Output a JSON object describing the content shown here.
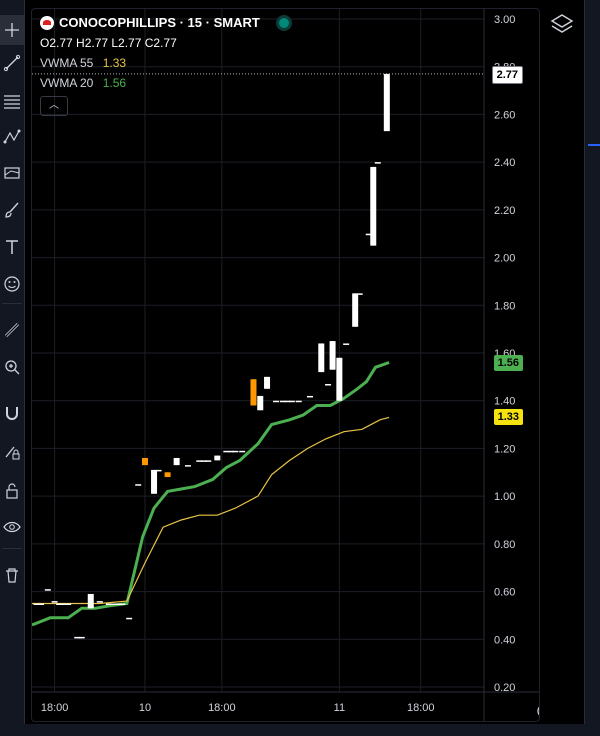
{
  "symbol": {
    "title": "CONOCOPHILLIPS · 15 · SMART",
    "ohlc": "O2.77 H2.77 L2.77 C2.77"
  },
  "indicators": [
    {
      "name": "VWMA 55",
      "value": "1.33",
      "color": "#e8c547"
    },
    {
      "name": "VWMA 20",
      "value": "1.56",
      "color": "#4caf50"
    }
  ],
  "price_tags": {
    "last": "2.77",
    "vwma20": "1.56",
    "vwma55": "1.33"
  },
  "colors": {
    "up": "#ffffff",
    "down": "#ff9800",
    "vwma20": "#4caf50",
    "vwma55": "#e8c547",
    "accent": "#2962ff"
  },
  "toolbar": {
    "icons": [
      "crosshair-icon",
      "trend-line-icon",
      "fib-icon",
      "pattern-icon",
      "forecast-icon",
      "brush-icon",
      "text-icon",
      "emoji-icon",
      "ruler-icon",
      "zoom-icon",
      "magnet-icon",
      "lock-drawings-icon",
      "lock-icon",
      "eye-icon",
      "trash-icon"
    ]
  },
  "chart_data": {
    "type": "candlestick",
    "y_axis": {
      "min": 0.2,
      "max": 3.0,
      "ticks": [
        "3.00",
        "2.80",
        "2.60",
        "2.40",
        "2.20",
        "2.00",
        "1.80",
        "1.60",
        "1.40",
        "1.20",
        "1.00",
        "0.80",
        "0.60",
        "0.40",
        "0.20"
      ]
    },
    "x_axis": {
      "labels": [
        "18:00",
        "10",
        "18:00",
        "11",
        "18:00"
      ],
      "positions": [
        0.05,
        0.25,
        0.42,
        0.68,
        0.86
      ]
    },
    "grid": true,
    "candles": [
      [
        0.01,
        0.55,
        0.55,
        0.55,
        0.55
      ],
      [
        0.02,
        0.55,
        0.55,
        0.55,
        0.55
      ],
      [
        0.035,
        0.61,
        0.61,
        0.61,
        0.61
      ],
      [
        0.05,
        0.56,
        0.56,
        0.56,
        0.56
      ],
      [
        0.06,
        0.55,
        0.55,
        0.55,
        0.55
      ],
      [
        0.07,
        0.55,
        0.55,
        0.55,
        0.55
      ],
      [
        0.08,
        0.55,
        0.55,
        0.55,
        0.55
      ],
      [
        0.1,
        0.41,
        0.41,
        0.41,
        0.41
      ],
      [
        0.11,
        0.41,
        0.41,
        0.41,
        0.41
      ],
      [
        0.13,
        0.53,
        0.59,
        0.53,
        0.59
      ],
      [
        0.15,
        0.56,
        0.56,
        0.56,
        0.56
      ],
      [
        0.17,
        0.55,
        0.55,
        0.55,
        0.55
      ],
      [
        0.18,
        0.55,
        0.55,
        0.55,
        0.55
      ],
      [
        0.19,
        0.55,
        0.55,
        0.55,
        0.55
      ],
      [
        0.2,
        0.55,
        0.55,
        0.55,
        0.55
      ],
      [
        0.215,
        0.49,
        0.49,
        0.49,
        0.49
      ],
      [
        0.235,
        1.05,
        1.05,
        1.05,
        1.05
      ],
      [
        0.25,
        1.16,
        1.16,
        1.13,
        1.13
      ],
      [
        0.27,
        1.01,
        1.11,
        1.01,
        1.11
      ],
      [
        0.28,
        1.11,
        1.11,
        1.11,
        1.11
      ],
      [
        0.3,
        1.1,
        1.1,
        1.08,
        1.08
      ],
      [
        0.32,
        1.13,
        1.16,
        1.13,
        1.16
      ],
      [
        0.345,
        1.13,
        1.13,
        1.13,
        1.13
      ],
      [
        0.37,
        1.15,
        1.15,
        1.15,
        1.15
      ],
      [
        0.38,
        1.15,
        1.15,
        1.15,
        1.15
      ],
      [
        0.39,
        1.15,
        1.15,
        1.15,
        1.15
      ],
      [
        0.41,
        1.15,
        1.17,
        1.15,
        1.17
      ],
      [
        0.43,
        1.19,
        1.19,
        1.19,
        1.19
      ],
      [
        0.44,
        1.19,
        1.19,
        1.19,
        1.19
      ],
      [
        0.45,
        1.19,
        1.19,
        1.19,
        1.19
      ],
      [
        0.465,
        1.19,
        1.19,
        1.19,
        1.19
      ],
      [
        0.49,
        1.49,
        1.49,
        1.38,
        1.38
      ],
      [
        0.505,
        1.36,
        1.42,
        1.36,
        1.42
      ],
      [
        0.52,
        1.45,
        1.5,
        1.45,
        1.5
      ],
      [
        0.54,
        1.4,
        1.4,
        1.4,
        1.4
      ],
      [
        0.555,
        1.4,
        1.4,
        1.4,
        1.4
      ],
      [
        0.565,
        1.4,
        1.4,
        1.4,
        1.4
      ],
      [
        0.575,
        1.4,
        1.4,
        1.4,
        1.4
      ],
      [
        0.59,
        1.4,
        1.4,
        1.4,
        1.4
      ],
      [
        0.615,
        1.42,
        1.42,
        1.42,
        1.42
      ],
      [
        0.64,
        1.52,
        1.64,
        1.52,
        1.64
      ],
      [
        0.655,
        1.47,
        1.47,
        1.47,
        1.47
      ],
      [
        0.665,
        1.53,
        1.65,
        1.53,
        1.65
      ],
      [
        0.68,
        1.4,
        1.58,
        1.4,
        1.58
      ],
      [
        0.695,
        1.64,
        1.64,
        1.64,
        1.64
      ],
      [
        0.715,
        1.71,
        1.85,
        1.71,
        1.85
      ],
      [
        0.725,
        1.85,
        1.85,
        1.85,
        1.85
      ],
      [
        0.745,
        2.1,
        2.1,
        2.1,
        2.1
      ],
      [
        0.755,
        2.05,
        2.38,
        2.05,
        2.38
      ],
      [
        0.765,
        2.4,
        2.4,
        2.4,
        2.4
      ],
      [
        0.785,
        2.53,
        2.77,
        2.53,
        2.77
      ]
    ],
    "series": [
      {
        "name": "VWMA 20",
        "color": "#4caf50",
        "x": [
          0.0,
          0.04,
          0.08,
          0.11,
          0.14,
          0.17,
          0.21,
          0.245,
          0.27,
          0.3,
          0.33,
          0.36,
          0.4,
          0.43,
          0.46,
          0.5,
          0.53,
          0.57,
          0.6,
          0.63,
          0.66,
          0.69,
          0.72,
          0.74,
          0.76,
          0.79
        ],
        "y": [
          0.46,
          0.49,
          0.49,
          0.53,
          0.53,
          0.54,
          0.55,
          0.83,
          0.95,
          1.02,
          1.03,
          1.04,
          1.07,
          1.12,
          1.15,
          1.22,
          1.3,
          1.32,
          1.34,
          1.38,
          1.38,
          1.41,
          1.45,
          1.48,
          1.54,
          1.56
        ]
      },
      {
        "name": "VWMA 55",
        "color": "#e8c547",
        "x": [
          0.0,
          0.05,
          0.1,
          0.15,
          0.21,
          0.25,
          0.29,
          0.33,
          0.37,
          0.41,
          0.45,
          0.5,
          0.53,
          0.57,
          0.61,
          0.65,
          0.69,
          0.73,
          0.77,
          0.79
        ],
        "y": [
          0.55,
          0.55,
          0.55,
          0.55,
          0.56,
          0.72,
          0.87,
          0.9,
          0.92,
          0.92,
          0.95,
          1.0,
          1.09,
          1.15,
          1.2,
          1.24,
          1.27,
          1.28,
          1.32,
          1.33
        ]
      }
    ]
  }
}
